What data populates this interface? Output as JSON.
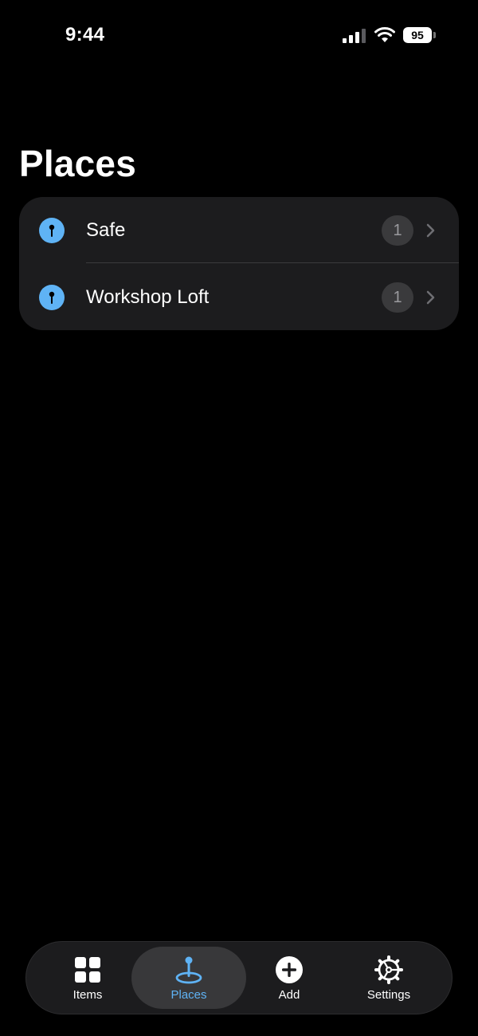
{
  "status_bar": {
    "time": "9:44",
    "battery": "95"
  },
  "page": {
    "title": "Places"
  },
  "places": [
    {
      "name": "Safe",
      "count": "1"
    },
    {
      "name": "Workshop Loft",
      "count": "1"
    }
  ],
  "tab_bar": {
    "tabs": [
      {
        "label": "Items",
        "icon": "grid-icon"
      },
      {
        "label": "Places",
        "icon": "map-pin-icon",
        "selected": true
      },
      {
        "label": "Add",
        "icon": "plus-circle-icon"
      },
      {
        "label": "Settings",
        "icon": "gear-icon"
      }
    ]
  },
  "colors": {
    "accent": "#5fb3f5",
    "background": "#000000",
    "card": "#1c1c1e"
  }
}
